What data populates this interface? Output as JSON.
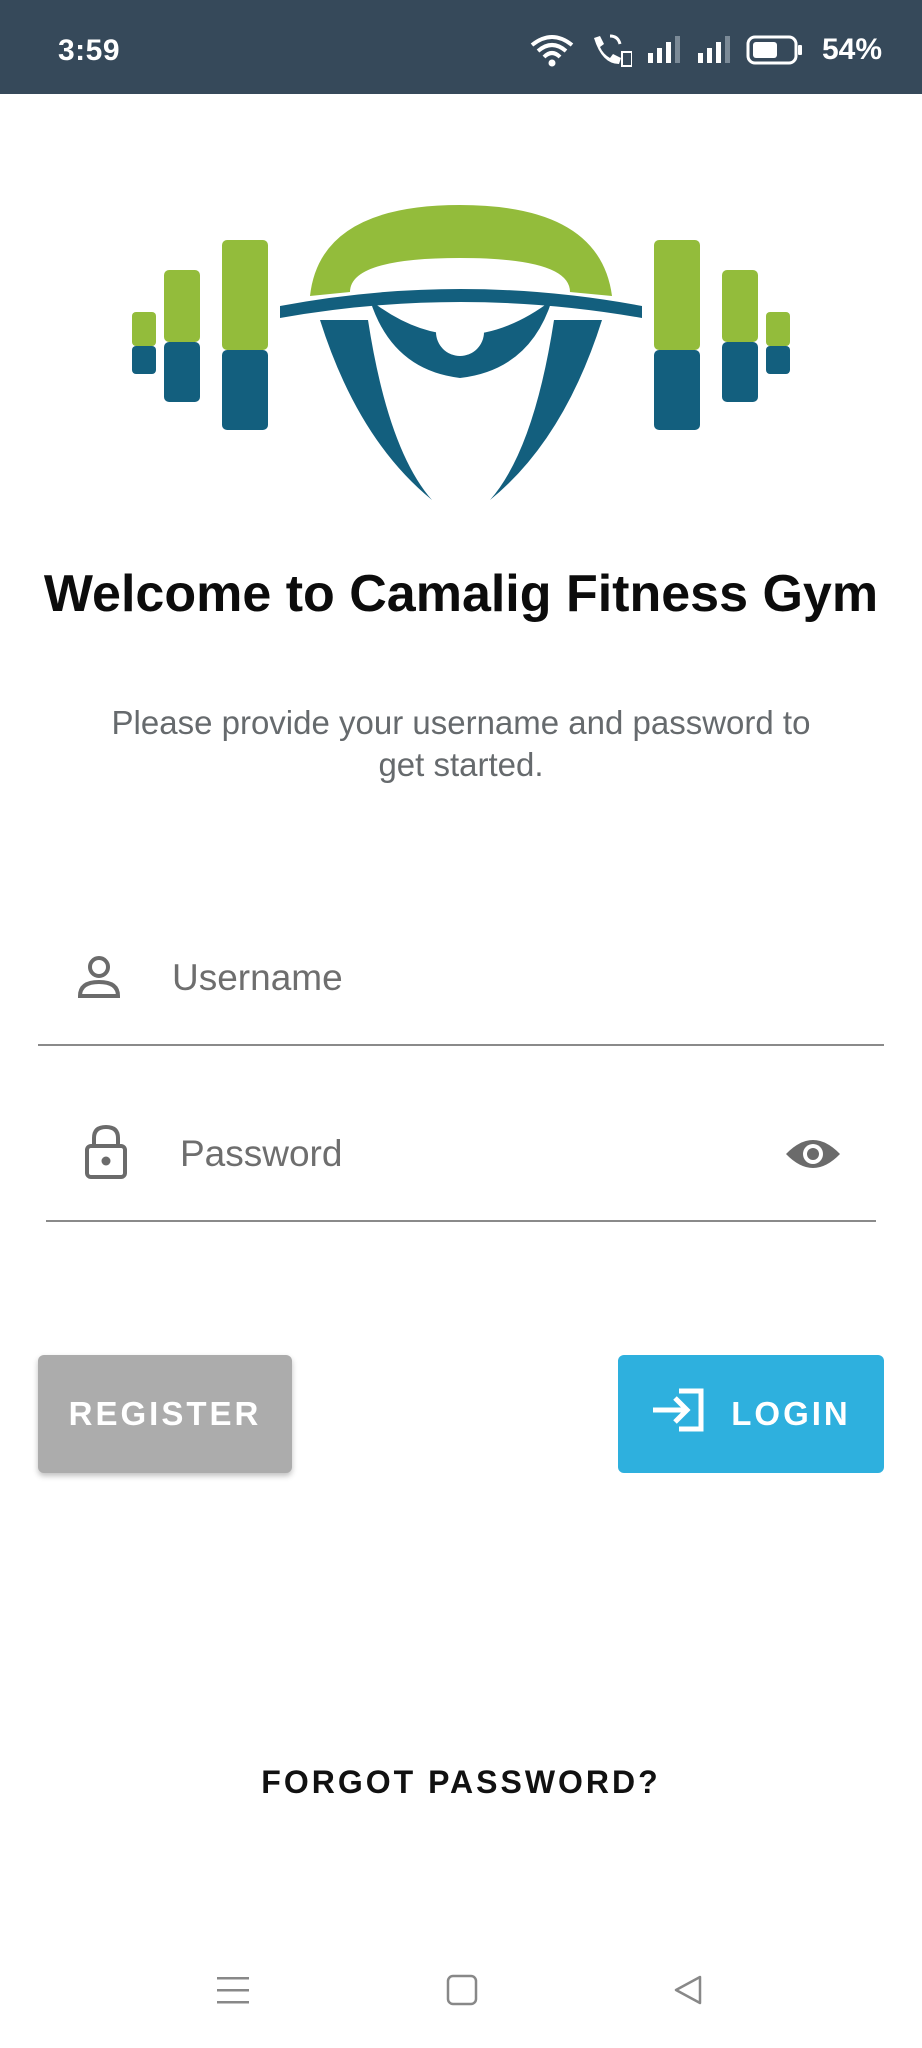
{
  "status_bar": {
    "time": "3:59",
    "battery": "54%",
    "icons": [
      "wifi-icon",
      "wifi-call-icon",
      "signal-icon",
      "signal-icon",
      "battery-icon"
    ]
  },
  "logo": {
    "icon": "dumbbell-lifter-logo",
    "colors": {
      "green": "#93bc3b",
      "blue": "#135f7e"
    }
  },
  "welcome": {
    "title": "Welcome to Camalig Fitness Gym",
    "subtitle": "Please provide your username and password to get started."
  },
  "form": {
    "username": {
      "placeholder": "Username",
      "value": "",
      "icon": "person-icon"
    },
    "password": {
      "placeholder": "Password",
      "value": "",
      "icon": "lock-icon",
      "toggle_icon": "eye-icon"
    }
  },
  "buttons": {
    "register_label": "REGISTER",
    "login_label": "LOGIN",
    "login_icon": "login-arrow-icon",
    "register_color": "#acacac",
    "login_color": "#2eb0de"
  },
  "forgot_password": "FORGOT PASSWORD?",
  "nav": {
    "icons": [
      "menu-icon",
      "home-icon",
      "back-icon"
    ]
  }
}
